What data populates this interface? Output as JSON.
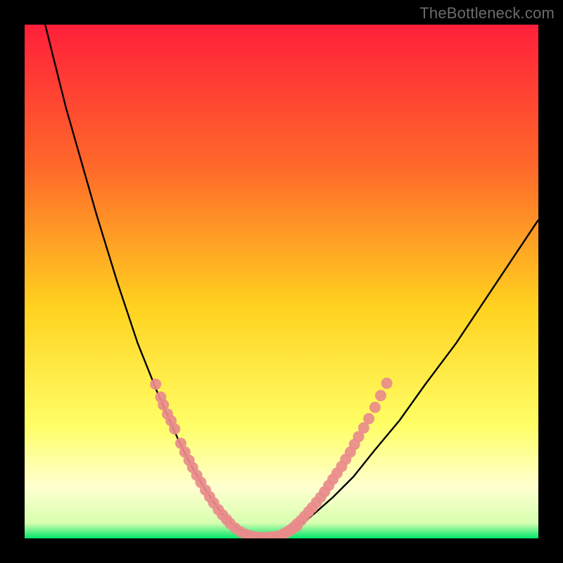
{
  "watermark": "TheBottleneck.com",
  "colors": {
    "bg": "#000000",
    "gradient_top": "#ff1f3a",
    "gradient_mid_upper": "#ff6a2a",
    "gradient_mid": "#ffd21f",
    "gradient_lower": "#ffff66",
    "gradient_pale": "#ffffd0",
    "gradient_bottom": "#00e56a",
    "curve": "#000000",
    "marker": "#e98b8b"
  },
  "chart_data": {
    "type": "line",
    "title": "",
    "xlabel": "",
    "ylabel": "",
    "xlim": [
      0,
      100
    ],
    "ylim": [
      0,
      100
    ],
    "series": [
      {
        "name": "bottleneck-curve",
        "x": [
          4,
          6,
          8,
          10,
          12,
          14,
          16,
          18,
          20,
          22,
          24,
          26,
          28,
          30,
          32,
          34,
          35.5,
          37,
          38.5,
          40,
          41.5,
          43,
          44.5,
          46,
          48,
          50,
          53,
          56,
          60,
          64,
          68,
          73,
          78,
          84,
          90,
          96,
          100
        ],
        "y": [
          100,
          92,
          84,
          77,
          70,
          63,
          56.5,
          50,
          44,
          38,
          33,
          28,
          23.5,
          19,
          15,
          11.5,
          9,
          6.8,
          4.8,
          3.2,
          2,
          1,
          0.4,
          0.2,
          0.2,
          0.6,
          2,
          4.5,
          8,
          12,
          17,
          23,
          30,
          38,
          47,
          56,
          62
        ]
      }
    ],
    "markers": [
      {
        "name": "left-cluster",
        "points": [
          [
            25.5,
            30.0
          ],
          [
            26.5,
            27.5
          ],
          [
            27.0,
            26.0
          ],
          [
            27.8,
            24.2
          ],
          [
            28.5,
            22.9
          ],
          [
            29.2,
            21.3
          ],
          [
            30.4,
            18.5
          ],
          [
            31.2,
            16.8
          ],
          [
            32.0,
            15.2
          ],
          [
            32.7,
            13.8
          ],
          [
            33.5,
            12.3
          ],
          [
            34.3,
            10.9
          ],
          [
            35.2,
            9.4
          ],
          [
            36.0,
            8.1
          ],
          [
            36.8,
            6.9
          ],
          [
            37.7,
            5.6
          ],
          [
            38.5,
            4.6
          ],
          [
            39.3,
            3.7
          ],
          [
            40.0,
            2.9
          ]
        ]
      },
      {
        "name": "bottom-cluster",
        "points": [
          [
            41.0,
            2.0
          ],
          [
            42.0,
            1.3
          ],
          [
            43.0,
            0.8
          ],
          [
            44.0,
            0.5
          ],
          [
            45.0,
            0.3
          ],
          [
            46.0,
            0.2
          ],
          [
            47.0,
            0.2
          ],
          [
            48.0,
            0.3
          ],
          [
            49.0,
            0.4
          ],
          [
            50.0,
            0.6
          ],
          [
            51.0,
            1.2
          ],
          [
            52.0,
            1.8
          ],
          [
            53.0,
            2.4
          ]
        ]
      },
      {
        "name": "right-cluster",
        "points": [
          [
            50.5,
            0.9
          ],
          [
            51.5,
            1.5
          ],
          [
            52.3,
            2.1
          ],
          [
            53.0,
            2.8
          ],
          [
            53.8,
            3.5
          ],
          [
            54.5,
            4.3
          ],
          [
            55.3,
            5.2
          ],
          [
            56.0,
            6.0
          ],
          [
            56.8,
            7.0
          ],
          [
            57.6,
            8.0
          ],
          [
            58.4,
            9.1
          ],
          [
            59.2,
            10.3
          ],
          [
            60.0,
            11.5
          ],
          [
            60.8,
            12.7
          ],
          [
            61.7,
            14.0
          ],
          [
            62.5,
            15.4
          ],
          [
            63.4,
            16.8
          ],
          [
            64.2,
            18.3
          ],
          [
            65.0,
            19.8
          ],
          [
            66.0,
            21.5
          ],
          [
            67.0,
            23.3
          ],
          [
            68.2,
            25.5
          ],
          [
            69.3,
            27.8
          ],
          [
            70.5,
            30.2
          ]
        ]
      }
    ],
    "marker_radius_px": 8
  }
}
